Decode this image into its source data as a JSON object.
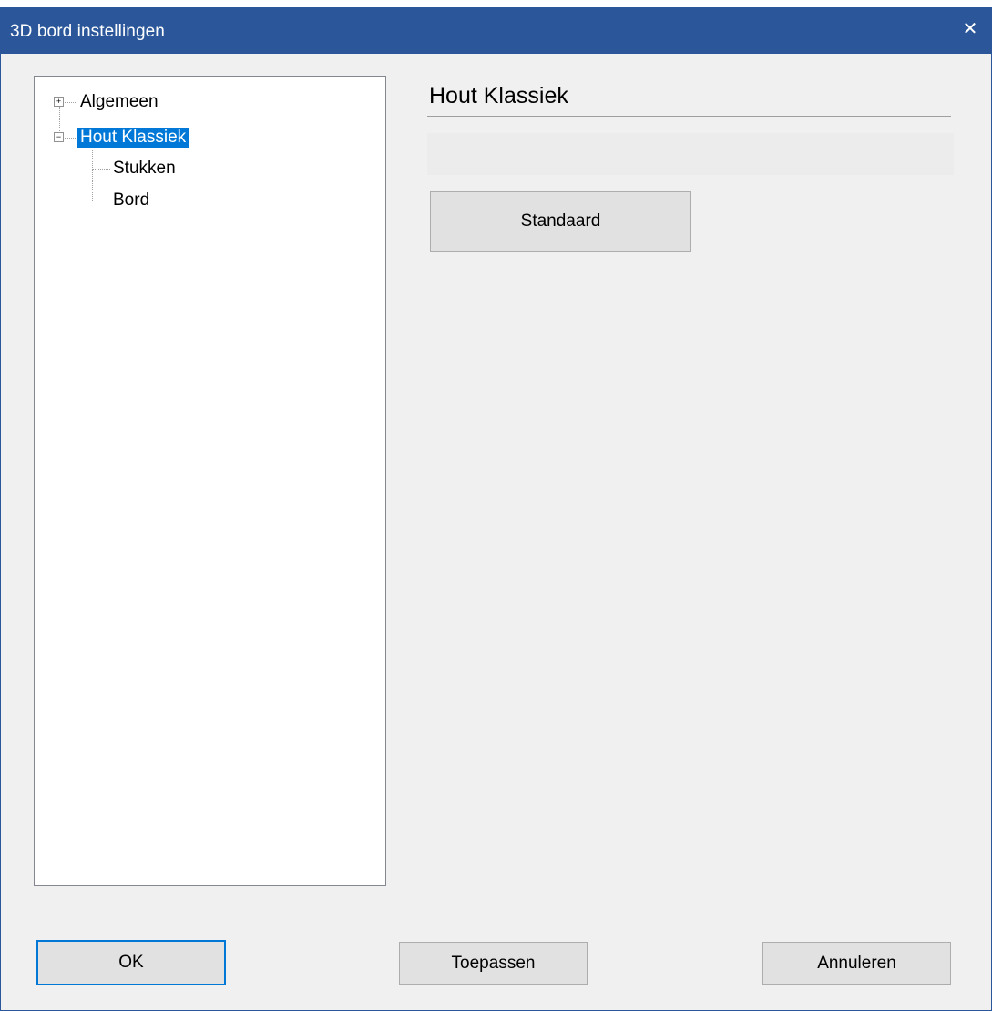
{
  "window": {
    "title": "3D bord instellingen",
    "close_glyph": "✕"
  },
  "tree": {
    "items": [
      {
        "label": "Algemeen",
        "expander": "+",
        "level": 0
      },
      {
        "label": "Hout Klassiek",
        "expander": "−",
        "level": 0,
        "selected": true
      },
      {
        "label": "Stukken",
        "level": 1
      },
      {
        "label": "Bord",
        "level": 1
      }
    ]
  },
  "panel": {
    "title": "Hout Klassiek",
    "reset_button": "Standaard"
  },
  "footer": {
    "ok": "OK",
    "apply": "Toepassen",
    "cancel": "Annuleren"
  },
  "colors": {
    "titlebar": "#2b579a",
    "selection": "#0078d7",
    "background": "#f0f0f0"
  }
}
